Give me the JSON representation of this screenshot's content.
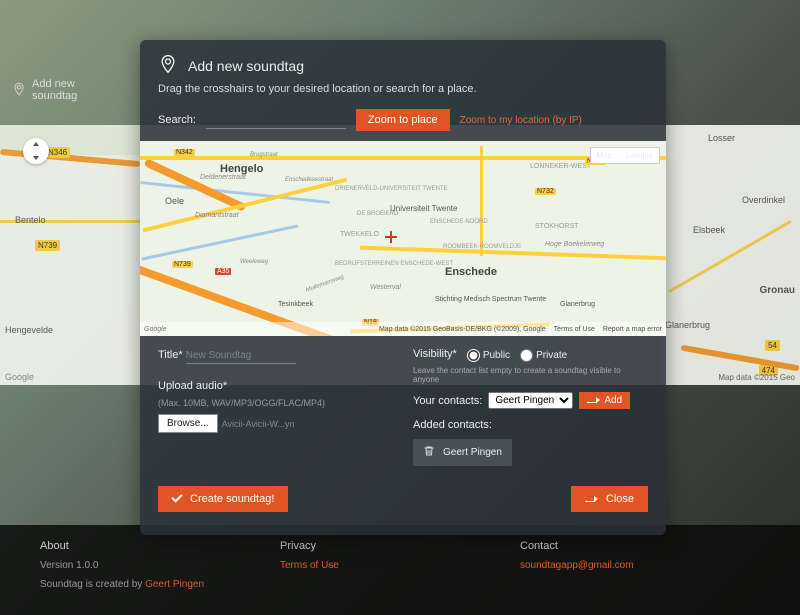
{
  "sidepanel": {
    "add_label": "Add new soundtag"
  },
  "modal": {
    "title": "Add new soundtag",
    "subtitle": "Drag the crosshairs to your desired location or search for a place.",
    "search_label": "Search:",
    "zoom_button": "Zoom to place",
    "zoom_ip_link": "Zoom to my location (by IP)",
    "title_label": "Title*",
    "title_placeholder": "New Soundtag",
    "upload_label": "Upload audio*",
    "upload_hint": "(Max. 10MB, WAV/MP3/OGG/FLAC/MP4)",
    "browse_label": "Browse...",
    "filename": "Avicii-Avicii-W...yn",
    "visibility_label": "Visibility*",
    "vis_public": "Public",
    "vis_private": "Private",
    "vis_note": "Leave the contact list empty to create a soundtag visible to anyone",
    "contacts_label": "Your contacts:",
    "contact_option": "Geert Pingen",
    "add_button": "Add",
    "added_label": "Added contacts:",
    "added_contact": "Geert Pingen",
    "create_button": "Create soundtag!",
    "close_button": "Close"
  },
  "map": {
    "type_map": "Map",
    "type_sat": "Satellite",
    "google": "Google",
    "attrib": "Map data ©2015 GeoBasis-DE/BKG (©2009), Google",
    "terms": "Terms of Use",
    "report": "Report a map error",
    "places": {
      "hengelo": "Hengelo",
      "enschede": "Enschede",
      "oele": "Oele",
      "twekkelo": "TWEKKELO",
      "universiteit": "Universiteit Twente",
      "drieneveld": "DRIENERVELD-UNIVERSITEIT TWENTE",
      "lonneker": "LONNEKER-WEST",
      "stokhorst": "STOKHORST",
      "enschede_noord": "ENSCHEDE-NOORD",
      "broederen": "DE BROEIERD",
      "bedrijf": "BEDRIJFSTERREINEN ENSCHEDE-WEST",
      "tesink": "Tesinkbeek",
      "westerval": "Westerval",
      "roombeek": "ROOMBEEK-ROOMVELDJE",
      "spectrum": "Stichting Medisch Spectrum Twente",
      "mollenweg": "Mollemansweg",
      "weele": "Weeleweg",
      "hoge": "Hoge Boekelerweg",
      "diamant": "Diamantstraat",
      "delden": "Deldenerstraat",
      "brug": "Brugstraat",
      "ensched": "Enschedesestraat"
    },
    "badges": {
      "n342": "N342",
      "n739": "N739",
      "a35": "A35",
      "n733": "N733",
      "n732": "N732",
      "n18": "N18"
    }
  },
  "bgmap": {
    "places": {
      "bentelo": "Bentelo",
      "hengevelde": "Hengevelde",
      "losser": "Losser",
      "overdinkel": "Overdinkel",
      "gronau": "Gronau",
      "glanerbrug": "Glanerbrug",
      "elsbeek": "Elsbeek"
    },
    "badges": {
      "n346": "N346",
      "n739": "N739",
      "k54": "54",
      "a74": "474"
    },
    "google": "Google",
    "attrib": "Map data ©2015 Geo"
  },
  "footer": {
    "about_hd": "About",
    "version": "Version 1.0.0",
    "created": "Soundtag is created by ",
    "creator": "Geert Pingen",
    "privacy_hd": "Privacy",
    "terms": "Terms of Use",
    "contact_hd": "Contact",
    "email": "soundtagapp@gmail.com"
  }
}
